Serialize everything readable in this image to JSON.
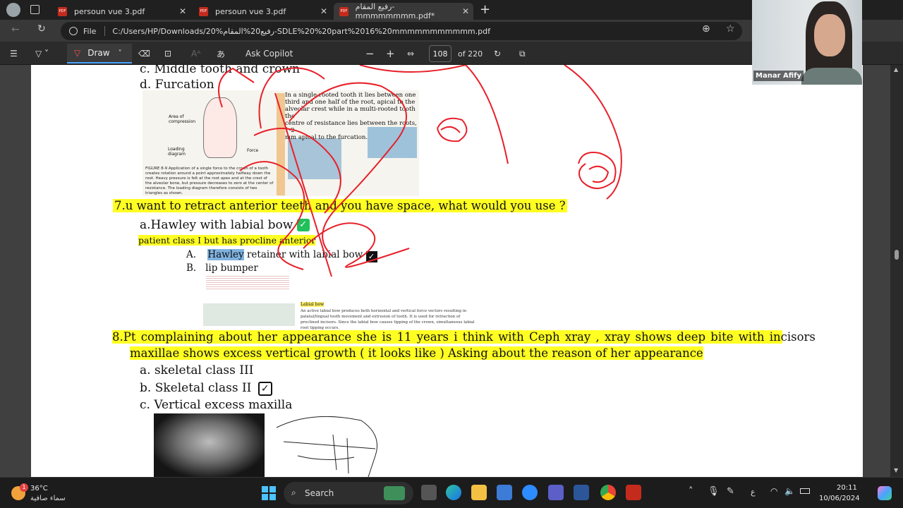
{
  "tabs": [
    {
      "title": "persoun vue 3.pdf"
    },
    {
      "title": "persoun vue 3.pdf"
    },
    {
      "title": "رفيع المقام- mmmmmmmm.pdf*"
    }
  ],
  "new_tab": "+",
  "address": {
    "label": "File",
    "url": "C:/Users/HP/Downloads/20%رفيع20%المقام-SDLE%20%20part%2016%20mmmmmmmmmmm.pdf"
  },
  "toolbar": {
    "draw": "Draw",
    "ask": "Ask Copilot",
    "page": "108",
    "of": "of 220",
    "minus": "−",
    "plus": "+"
  },
  "doc": {
    "q6c": "c. Middle tooth and crown",
    "q6d": "d. Furcation",
    "fig_text": [
      "In a single-rooted tooth it lies between one",
      "third and one half of the root, apical to the",
      "alveolar crest while in a multi-rooted tooth the",
      "centre of resistance lies between the roots, 1-2",
      "mm apical to the furcation."
    ],
    "fig_caption": "FIGURE 8-9  Application of a single force to the crown of a tooth creates rotation around a point approximately halfway down the root. Heavy pressure is felt at the root apex and at the crest of the alveolar bone, but pressure decreases to zero at the center of resistance. The loading diagram therefore consists of two triangles as shown.",
    "fig_labels": {
      "area": "Area of compression",
      "loading": "Loading diagram",
      "force": "Force"
    },
    "q7": "7.u want to retract anterior teeth and you have space, what would you use ?",
    "q7a": "a.Hawley with labial bow",
    "q7note": "patient class I but has procline anterior",
    "q7A_prefix": "A.",
    "q7A_hl": "Hawley",
    "q7A_rest": " retainer with labial bow",
    "q7B": "B.   lip bumper",
    "labial_bow": "Labial bow",
    "lb_text": "An active labial bow produces both horizontal and vertical force vectors resulting in palatal/lingual tooth movement and extrusion of tooth. It is used for retraction of proclined incisors. Since the labial bow causes tipping of the crown, simultaneous labial root tipping occurs.",
    "q8_l1": "8.Pt complaining about her appearance she is 11 years i think with Ceph xray , xray shows deep bite with incisors",
    "q8_l2": "maxillae shows excess vertical growth ( it looks like ) Asking about the reason of her appearance",
    "q8a": "a. skeletal class III",
    "q8b": "b. Skeletal class II",
    "q8c": "c. Vertical excess maxilla"
  },
  "webcam": {
    "name": "Manar Afify"
  },
  "weather": {
    "temp": "36°C",
    "desc": "سماء صافية",
    "badge": "1"
  },
  "taskbar": {
    "search": "Search",
    "time": "20:11",
    "date": "10/06/2024",
    "lang": "ع"
  },
  "colors": {
    "highlight": "#ffff22",
    "ink": "#e8202a",
    "check": "#21c05a",
    "hawley_hl": "#7fb2e0"
  }
}
